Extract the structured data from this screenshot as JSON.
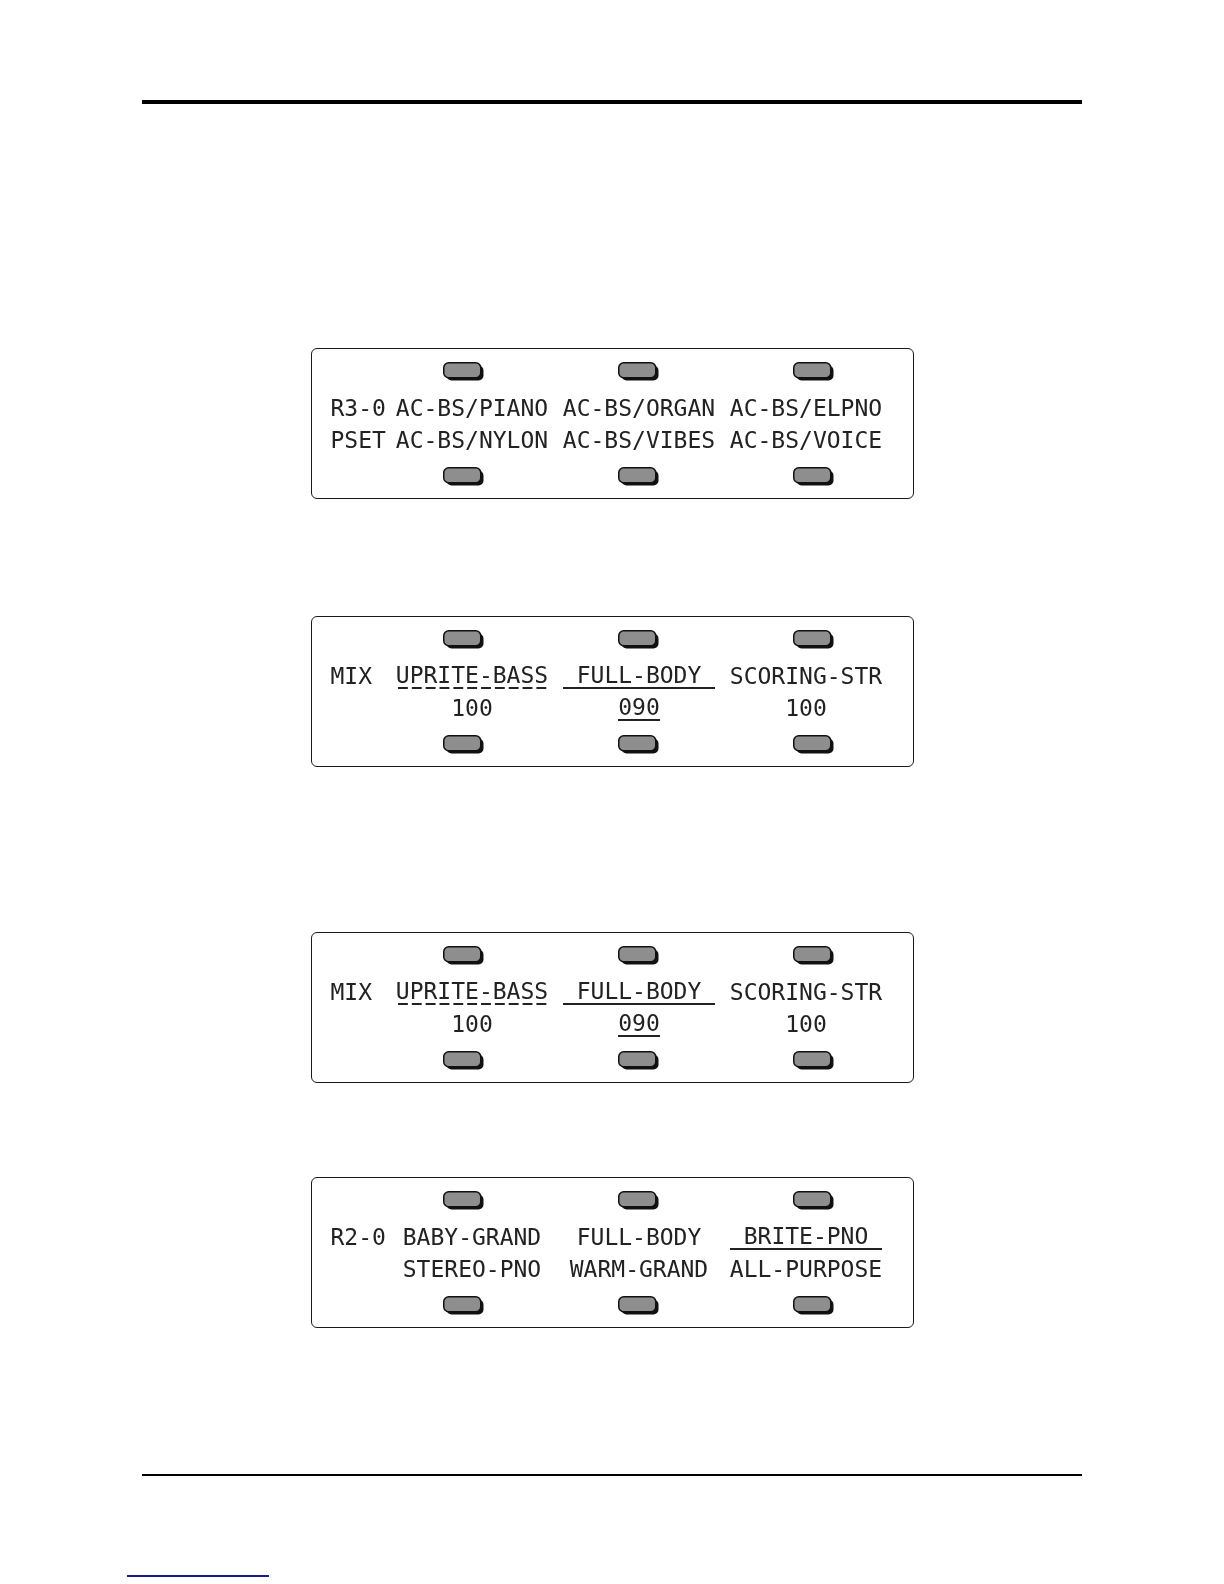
{
  "displays": [
    {
      "rows": [
        {
          "kind": "names",
          "label": "R3-0",
          "cells": [
            {
              "text": "AC-BS/PIANO",
              "selected": false,
              "underlined": false
            },
            {
              "text": "AC-BS/ORGAN",
              "selected": false,
              "underlined": false
            },
            {
              "text": "AC-BS/ELPNO",
              "selected": false,
              "underlined": false
            }
          ]
        },
        {
          "kind": "names",
          "label": "PSET",
          "cells": [
            {
              "text": "AC-BS/NYLON",
              "selected": false,
              "underlined": false
            },
            {
              "text": "AC-BS/VIBES",
              "selected": false,
              "underlined": false
            },
            {
              "text": "AC-BS/VOICE",
              "selected": false,
              "underlined": false
            }
          ]
        }
      ]
    },
    {
      "rows": [
        {
          "kind": "names",
          "label": "MIX",
          "cells": [
            {
              "text": "UPRITE-BASS",
              "selected": false,
              "underlined": true
            },
            {
              "text": "FULL-BODY",
              "selected": true,
              "underlined": false
            },
            {
              "text": "SCORING-STR",
              "selected": false,
              "underlined": false
            }
          ]
        },
        {
          "kind": "values",
          "cells": [
            {
              "text": "100",
              "selected": false,
              "underlined": false
            },
            {
              "text": "090",
              "selected": true,
              "underlined": false
            },
            {
              "text": "100",
              "selected": false,
              "underlined": false
            }
          ]
        }
      ]
    },
    {
      "rows": [
        {
          "kind": "names",
          "label": "MIX",
          "cells": [
            {
              "text": "UPRITE-BASS",
              "selected": false,
              "underlined": true
            },
            {
              "text": "FULL-BODY",
              "selected": true,
              "underlined": false
            },
            {
              "text": "SCORING-STR",
              "selected": false,
              "underlined": false
            }
          ]
        },
        {
          "kind": "values",
          "cells": [
            {
              "text": "100",
              "selected": false,
              "underlined": false
            },
            {
              "text": "090",
              "selected": true,
              "underlined": false
            },
            {
              "text": "100",
              "selected": false,
              "underlined": false
            }
          ]
        }
      ]
    },
    {
      "rows": [
        {
          "kind": "names",
          "label": "R2-0",
          "cells": [
            {
              "text": "BABY-GRAND",
              "selected": false,
              "underlined": false
            },
            {
              "text": "FULL-BODY",
              "selected": false,
              "underlined": false
            },
            {
              "text": "BRITE-PNO",
              "selected": true,
              "underlined": false
            }
          ]
        },
        {
          "kind": "names",
          "cells": [
            {
              "text": "STEREO-PNO",
              "selected": false,
              "underlined": false
            },
            {
              "text": "WARM-GRAND",
              "selected": false,
              "underlined": false
            },
            {
              "text": "ALL-PURPOSE",
              "selected": false,
              "underlined": false
            }
          ]
        }
      ]
    }
  ]
}
